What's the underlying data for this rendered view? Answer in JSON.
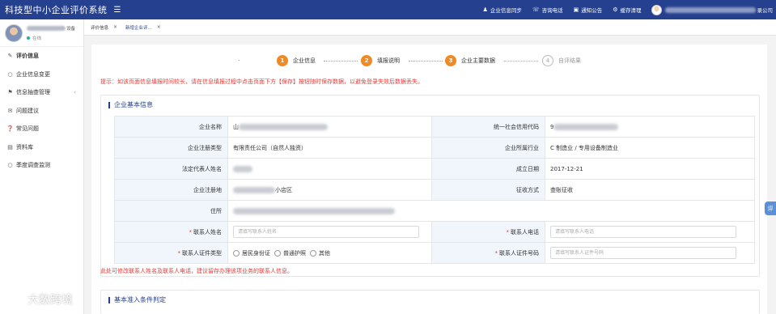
{
  "app": {
    "title": "科技型中小企业评价系统",
    "menu_icon": "hamburger-icon"
  },
  "topbar": {
    "items": [
      {
        "icon": "user-icon",
        "label": "企业信息同步"
      },
      {
        "icon": "phone-icon",
        "label": "咨询电话"
      },
      {
        "icon": "notice-icon",
        "label": "通知公告",
        "badge": ""
      },
      {
        "icon": "gear-icon",
        "label": "缓存清理"
      }
    ],
    "user_suffix": "录公司"
  },
  "sidebar": {
    "user_name_suffix": "设备",
    "user_status": "在线",
    "items": [
      {
        "icon": "edit-icon",
        "label": "评价信息",
        "active": true
      },
      {
        "icon": "circle-icon",
        "label": "企业信息变更"
      },
      {
        "icon": "tag-icon",
        "label": "信息抽查管理",
        "chevron": "‹"
      },
      {
        "icon": "comment-icon",
        "label": "问题建议"
      },
      {
        "icon": "question-icon",
        "label": "常见问题"
      },
      {
        "icon": "book-icon",
        "label": "资料库"
      },
      {
        "icon": "circle-icon",
        "label": "季度调查监测"
      }
    ]
  },
  "tabs": [
    {
      "label": "评价信息",
      "close": "×"
    },
    {
      "label": "新增企业评...",
      "close": "×"
    }
  ],
  "steps": [
    {
      "num": "1",
      "label": "企业信息",
      "state": "done"
    },
    {
      "num": "2",
      "label": "填报说明",
      "state": "done"
    },
    {
      "num": "3",
      "label": "企业主要数据",
      "state": "done"
    },
    {
      "num": "4",
      "label": "自评结果",
      "state": "pending"
    }
  ],
  "tip": "提示：如该页面信息填报时间较长，请在信息填报过程中点击页面下方【保存】按钮随时保存数据，以避免登录失效后数据丢失。",
  "section1": {
    "title": "企业基本信息",
    "rows": [
      {
        "l1": "企业名称",
        "v1_prefix": "山",
        "l2": "统一社会信用代码",
        "v2_prefix": "9"
      },
      {
        "l1": "企业注册类型",
        "v1": "有限责任公司（自然人独资）",
        "l2": "企业所属行业",
        "v2": "C 制造业 / 专用设备制造业"
      },
      {
        "l1": "法定代表人姓名",
        "l2": "成立日期",
        "v2": "2017-12-21"
      },
      {
        "l1": "企业注册地",
        "v1_suffix": "小店区",
        "l2": "征收方式",
        "v2": "查账征收"
      },
      {
        "l1": "住所"
      }
    ],
    "contact_name_label": "联系人姓名",
    "contact_name_placeholder": "请填写联系人姓名",
    "contact_phone_label": "联系人电话",
    "contact_phone_placeholder": "请填写联系人电话",
    "id_type_label": "联系人证件类型",
    "id_type_options": [
      "居民身份证",
      "普通护照",
      "其他"
    ],
    "id_no_label": "联系人证件号码",
    "id_no_placeholder": "请填写联系人证件号码",
    "required_mark": "*",
    "note": "此处可修改联系人姓名及联系人电话，建议留存办理该项业务的联系人信息。"
  },
  "section2": {
    "title": "基本准入条件判定"
  },
  "side_float": "评",
  "watermark": "大数跨境",
  "colors": {
    "topbar": "#24408e",
    "step_active": "#f08a24",
    "tip_red": "#e53935",
    "label_bg": "#f0f6fc"
  }
}
